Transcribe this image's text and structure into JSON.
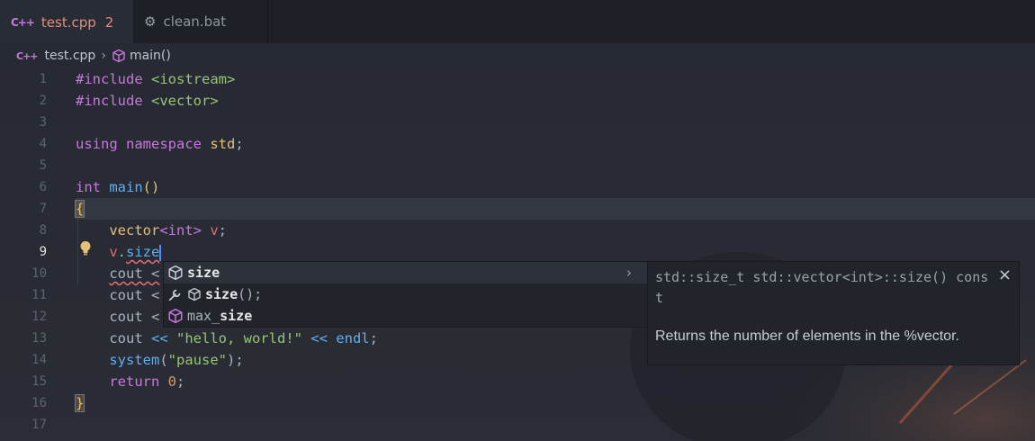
{
  "tabs": [
    {
      "label": "test.cpp",
      "icon": "cpp-file-icon",
      "problems": "2",
      "modified": true,
      "active": true
    },
    {
      "label": "clean.bat",
      "icon": "gear-icon",
      "active": false
    }
  ],
  "breadcrumb": {
    "file": "test.cpp",
    "symbol": "main()"
  },
  "editor": {
    "current_line": 9,
    "line_numbers": [
      "1",
      "2",
      "3",
      "4",
      "5",
      "6",
      "7",
      "8",
      "9",
      "10",
      "11",
      "12",
      "13",
      "14",
      "15",
      "16",
      "17"
    ],
    "lines": {
      "l1": {
        "directive": "#include ",
        "header": "<iostream>"
      },
      "l2": {
        "directive": "#include ",
        "header": "<vector>"
      },
      "l4": {
        "kw1": "using",
        "kw2": "namespace",
        "ns": "std",
        "semi": ";"
      },
      "l6": {
        "type": "int",
        "name": "main",
        "parens": "()"
      },
      "l7": {
        "brace": "{"
      },
      "l8": {
        "type": "vector",
        "targ": "<int>",
        "var": " v",
        "semi": ";"
      },
      "l9": {
        "obj": "v",
        "dot": ".",
        "member": "size"
      },
      "l10": {
        "text": "cout <"
      },
      "l11": {
        "text": "cout <"
      },
      "l12": {
        "text": "cout <"
      },
      "l13": {
        "cout": "cout",
        "op1": " << ",
        "str": "\"hello, world!\"",
        "op2": " << ",
        "endl": "endl",
        "semi": ";"
      },
      "l14": {
        "fn": "system",
        "open": "(",
        "str": "\"pause\"",
        "close": ")",
        "semi": ";"
      },
      "l15": {
        "kw": "return",
        "num": "0",
        "semi": ";"
      },
      "l16": {
        "brace": "}"
      }
    }
  },
  "suggestions": [
    {
      "label": "size",
      "icon": "method-icon",
      "selected": true
    },
    {
      "label": "size",
      "suffix": "();",
      "icon": "wrench-icon",
      "secondary_icon": "method-icon",
      "selected": false
    },
    {
      "label_rest": "max_",
      "label": "size",
      "icon": "method-icon",
      "selected": false
    }
  ],
  "suggest_details": {
    "signature": "std::size_t std::vector<int>::size() const",
    "documentation": "Returns the number of elements in the %vector."
  },
  "colors": {
    "accent": "#c678dd",
    "modified_tab": "#e88a7a",
    "string": "#98c379",
    "keyword": "#c678dd",
    "type": "#61afef",
    "namespace": "#e5c07b"
  }
}
